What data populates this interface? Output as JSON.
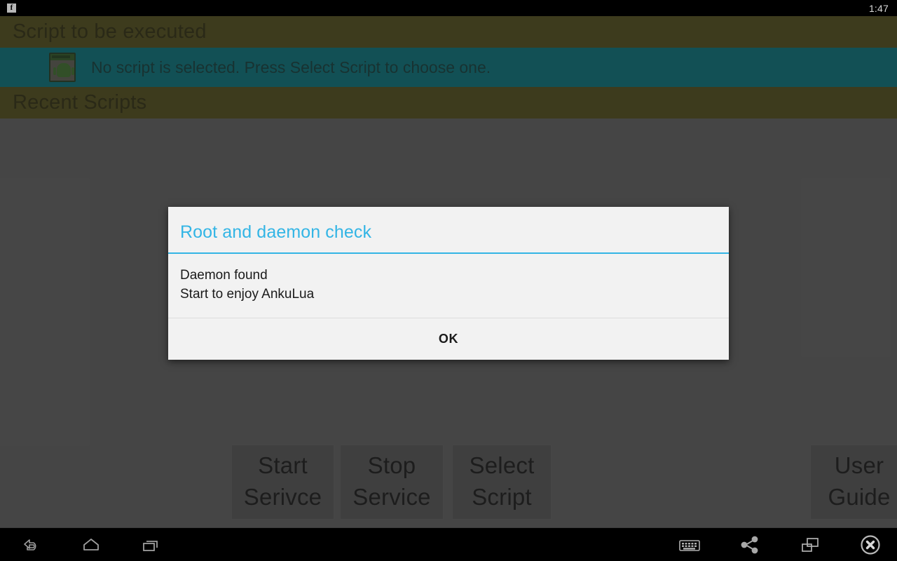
{
  "status_bar": {
    "notification_icon": "facebook-icon",
    "notification_label": "f",
    "clock": "1:47"
  },
  "app": {
    "sections": [
      {
        "title": "Script to be executed"
      },
      {
        "title": "Recent Scripts"
      }
    ],
    "script_row": {
      "icon": "android-script-icon",
      "message": "No script is selected. Press Select Script to choose one."
    },
    "buttons": [
      {
        "id": "start-service",
        "label": "Start\nSerivce"
      },
      {
        "id": "stop-service",
        "label": "Stop\nService"
      },
      {
        "id": "select-script",
        "label": "Select\nScript"
      },
      {
        "id": "user-guide",
        "label": "User\nGuide"
      }
    ]
  },
  "dialog": {
    "title": "Root and daemon check",
    "message": "Daemon found\nStart to enjoy AnkuLua",
    "ok_label": "OK"
  },
  "nav_bar": {
    "left": [
      {
        "name": "back-icon"
      },
      {
        "name": "home-icon"
      },
      {
        "name": "recents-icon"
      }
    ],
    "right": [
      {
        "name": "keyboard-icon"
      },
      {
        "name": "share-icon"
      },
      {
        "name": "screenshot-icon"
      },
      {
        "name": "close-icon"
      }
    ]
  },
  "colors": {
    "accent_blue": "#33b5e5",
    "header_olive": "#4f4b15",
    "row_teal": "#00727a",
    "background_gray": "#5e5e5e",
    "button_gray": "#535353",
    "dialog_bg": "#f2f2f2",
    "navbar_black": "#000000"
  }
}
